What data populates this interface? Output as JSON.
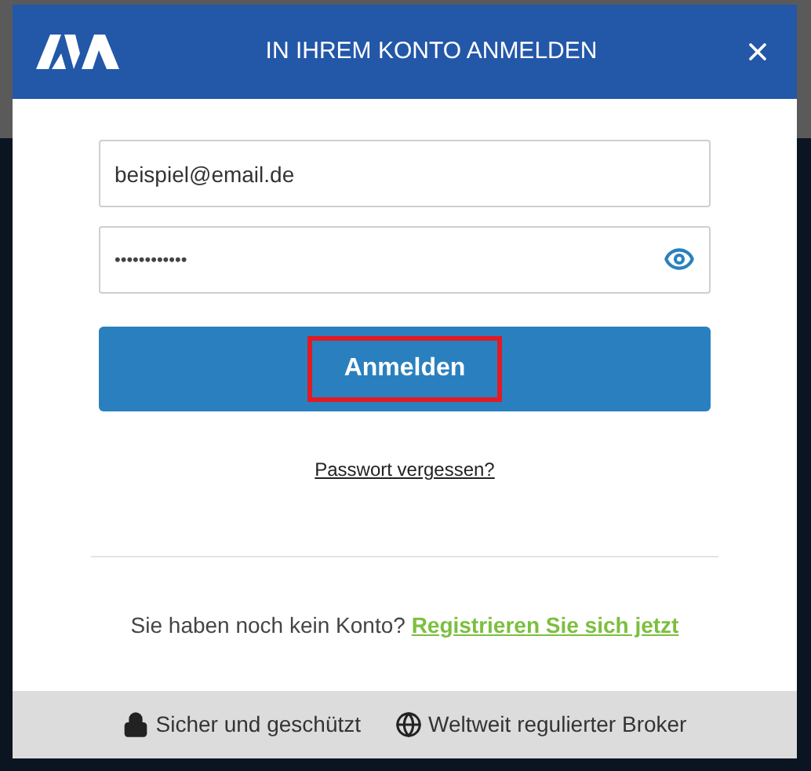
{
  "dialog": {
    "title": "IN IHREM KONTO ANMELDEN"
  },
  "email_field": {
    "value": "beispiel@email.de"
  },
  "password_field": {
    "value": "••••••••••••"
  },
  "login_button": {
    "label": "Anmelden",
    "highlighted": true
  },
  "forgot_link": "Passwort vergessen?",
  "register": {
    "text": "Sie haben noch kein Konto?",
    "link": "Registrieren Sie sich jetzt"
  },
  "footer": [
    {
      "kind": "lock",
      "text": "Sicher und geschützt"
    },
    {
      "kind": "globe",
      "text": "Weltweit regulierter Broker"
    }
  ]
}
